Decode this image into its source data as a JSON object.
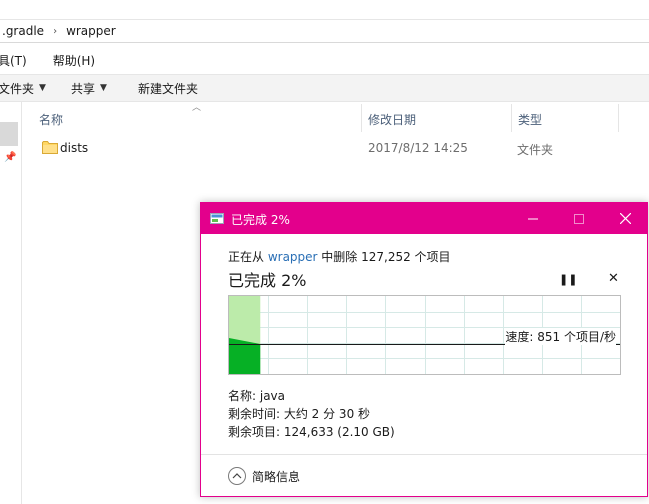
{
  "breadcrumb": {
    "segments": [
      ".gradle",
      "wrapper"
    ],
    "separator": "›"
  },
  "menubar": {
    "items": [
      "具(T)",
      "帮助(H)"
    ]
  },
  "toolbar": {
    "items": [
      "文件夹",
      "共享",
      "新建文件夹"
    ]
  },
  "file_list": {
    "columns": [
      "名称",
      "修改日期",
      "类型"
    ],
    "rows": [
      {
        "name": "dists",
        "modified": "2017/8/12 14:25",
        "type": "文件夹"
      }
    ]
  },
  "dialog": {
    "title": "已完成 2%",
    "status_prefix": "正在从 ",
    "status_source": "wrapper",
    "status_suffix": " 中删除 127,252 个项目",
    "percent_title": "已完成 2%",
    "progress_percent": 2,
    "speed_label": "速度: 851 个项目/秒",
    "details": {
      "name": "名称: java",
      "time_left": "剩余时间: 大约 2 分 30 秒",
      "items_left": "剩余项目: 124,633 (2.10 GB)"
    },
    "brief_label": "简略信息"
  },
  "colors": {
    "accent": "#e3008c",
    "link": "#2a6fb5",
    "progress_fill": "#06b025",
    "progress_light": "#bcebaa"
  },
  "icons": {
    "folder": "folder-icon",
    "pause": "pause-icon",
    "stop": "close-icon",
    "chevron": "chevron-up-icon"
  }
}
